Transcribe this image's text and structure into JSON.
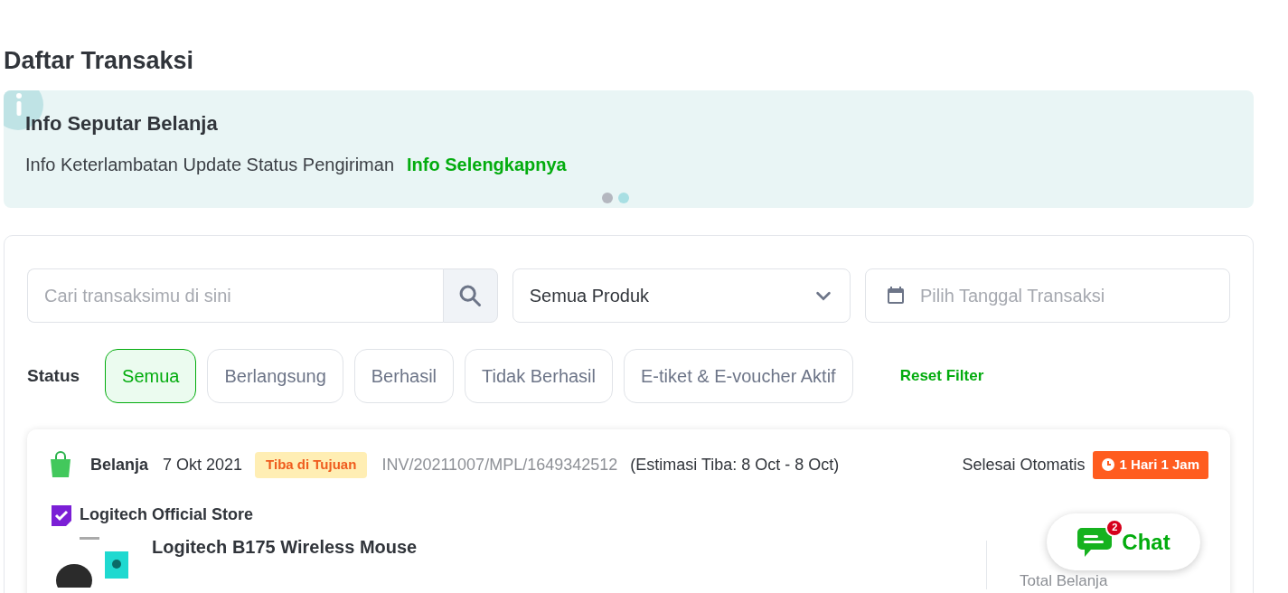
{
  "page_title": "Daftar Transaksi",
  "banner": {
    "title": "Info Seputar Belanja",
    "text": "Info Keterlambatan Update Status Pengiriman",
    "link": "Info Selengkapnya",
    "dots": [
      {
        "selected": false
      },
      {
        "selected": true
      }
    ]
  },
  "filters": {
    "search": {
      "placeholder": "Cari transaksimu di sini"
    },
    "product_select": {
      "value": "Semua Produk"
    },
    "date": {
      "placeholder": "Pilih Tanggal Transaksi"
    }
  },
  "status": {
    "label": "Status",
    "chips": [
      {
        "label": "Semua",
        "selected": true
      },
      {
        "label": "Berlangsung",
        "selected": false
      },
      {
        "label": "Berhasil",
        "selected": false
      },
      {
        "label": "Tidak Berhasil",
        "selected": false
      },
      {
        "label": "E-tiket & E-voucher Aktif",
        "selected": false
      }
    ],
    "reset": "Reset Filter"
  },
  "order": {
    "category": "Belanja",
    "date": "7 Okt 2021",
    "badge": "Tiba di Tujuan",
    "invoice": "INV/20211007/MPL/1649342512",
    "estimate": "(Estimasi Tiba: 8 Oct - 8 Oct)",
    "auto_label": "Selesai Otomatis",
    "countdown": "1 Hari 1 Jam",
    "store": "Logitech Official Store",
    "product": "Logitech B175 Wireless Mouse",
    "total_label": "Total Belanja"
  },
  "chat": {
    "label": "Chat",
    "count": "2"
  }
}
